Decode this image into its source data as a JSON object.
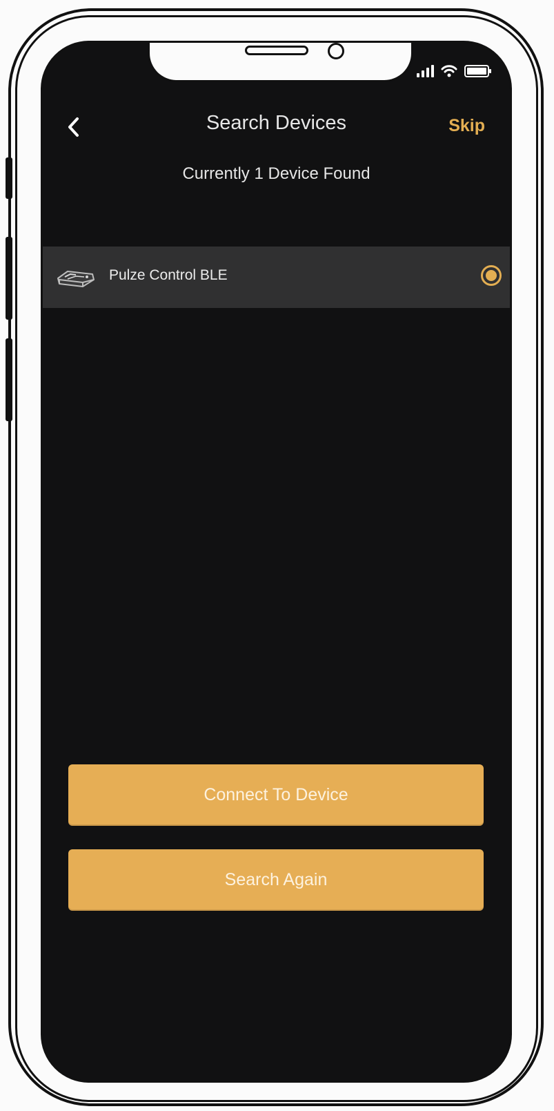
{
  "header": {
    "title": "Search Devices",
    "skip_label": "Skip"
  },
  "status": "Currently 1 Device Found",
  "devices": [
    {
      "name": "Pulze Control BLE",
      "icon": "controller-device-icon",
      "selected": true
    }
  ],
  "actions": {
    "connect_label": "Connect To Device",
    "search_again_label": "Search Again"
  },
  "colors": {
    "accent": "#e3ae52",
    "button": "#e6ae55",
    "background": "#111112",
    "row": "#303031"
  }
}
